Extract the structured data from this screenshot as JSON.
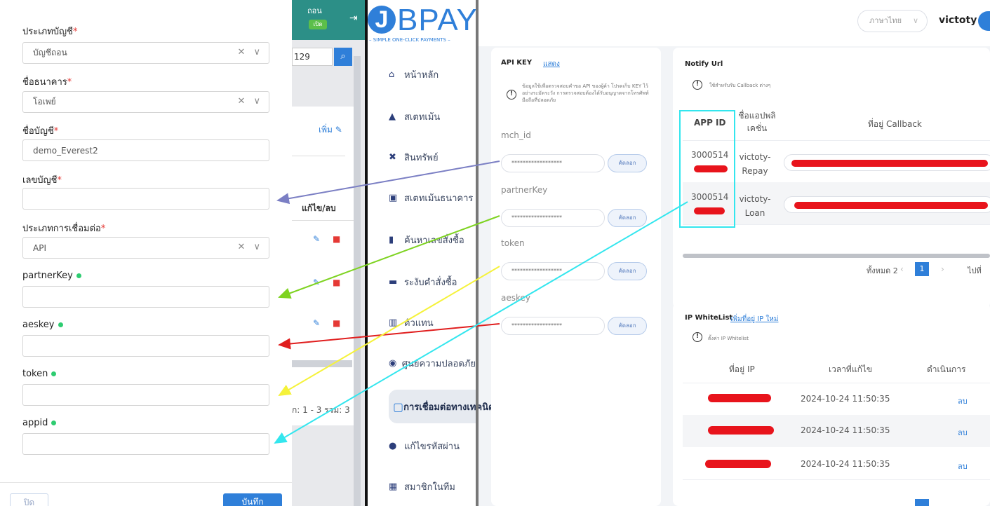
{
  "form": {
    "account_type": {
      "label": "ประเภทบัญชี",
      "req": "*",
      "value": "บัญชีถอน",
      "icons": "✕ ∨"
    },
    "bank_name": {
      "label": "ชื่อธนาคาร",
      "req": "*",
      "value": "โอเพย์",
      "icons": "✕ ∨"
    },
    "account_name": {
      "label": "ชื่อบัญชี",
      "req": "*",
      "value": "demo_Everest2"
    },
    "account_number": {
      "label": "เลขบัญชี",
      "req": "*",
      "value": ""
    },
    "connection_type": {
      "label": "ประเภทการเชื่อมต่อ",
      "req": "*",
      "value": "API",
      "icons": "✕ ∨"
    },
    "partnerKey": {
      "label": "partnerKey",
      "value": ""
    },
    "aeskey": {
      "label": "aeskey",
      "value": ""
    },
    "token": {
      "label": "token",
      "value": ""
    },
    "appid": {
      "label": "appid",
      "value": ""
    },
    "cancel_label": "ปิด",
    "save_label": "บันทึก"
  },
  "mid": {
    "withdraw_label": "ถอน",
    "toggle_label": "เปิด",
    "search_value": "129",
    "add_label": "เพิ่ม",
    "col_header": "แก้ไข/ลบ",
    "footer": "ก: 1 - 3 รวม: 3"
  },
  "brand": {
    "name": "BPAY",
    "initial": "J",
    "tagline": "– SIMPLE ONE-CLICK PAYMENTS –",
    "accent": "#2f7fd9"
  },
  "topbar": {
    "language": "ภาษาไทย",
    "username": "victoty"
  },
  "nav": [
    {
      "icon": "home-icon",
      "glyph": "⌂",
      "label": "หน้าหลัก"
    },
    {
      "icon": "bag-icon",
      "glyph": "▲",
      "label": "สเตทเม้น"
    },
    {
      "icon": "assets-icon",
      "glyph": "✖",
      "label": "สินทรัพย์"
    },
    {
      "icon": "clipboard-icon",
      "glyph": "▣",
      "label": "สเตทเม้นธนาคาร"
    },
    {
      "icon": "chart-icon",
      "glyph": "▮",
      "label": "ค้นหาเลขสั่งซื้อ"
    },
    {
      "icon": "order-icon",
      "glyph": "▬",
      "label": "ระงับคำสั่งซื้อ"
    },
    {
      "icon": "agent-icon",
      "glyph": "▥",
      "label": "ตัวแทน"
    },
    {
      "icon": "shield-icon",
      "glyph": "◉",
      "label": "ศูนย์ความปลอดภัย"
    },
    {
      "icon": "connect-icon",
      "glyph": "▢",
      "label": "การเชื่อมต่อทางเทคนิค"
    },
    {
      "icon": "user-icon",
      "glyph": "●",
      "label": "แก้ไขรหัสผ่าน"
    },
    {
      "icon": "grid-icon",
      "glyph": "▦",
      "label": "สมาชิกในทีม"
    }
  ],
  "apikey": {
    "title": "API KEY",
    "show_link": "แสดง",
    "note": "ข้อมูลใช้เพื่อตรวจสอบคำขอ API ของผู้ค้า โปรดเก็บ KEY ไว้อย่างระมัดระวัง การตรวจสอบต้องได้รับอนุญาตจากโทรศัพท์มือถือที่ปลอดภัย",
    "masked": "******************",
    "copy_label": "คัดลอก",
    "fields": [
      "mch_id",
      "partnerKey",
      "token",
      "aeskey"
    ]
  },
  "notify": {
    "title": "Notify Url",
    "note": "ใช้สำหรับรับ Callback ต่างๆ",
    "headers": {
      "app_id": "APP ID",
      "app_name": "ชื่อแอปพลิเคชั่น",
      "callback": "ที่อยู่ Callback"
    },
    "rows": [
      {
        "app_id": "3000514",
        "app_name": "victoty-Repay"
      },
      {
        "app_id": "3000514",
        "app_name": "victoty-Loan"
      }
    ],
    "pager": {
      "total": "ทั้งหมด 2",
      "page": "1",
      "goto": "ไปที่"
    }
  },
  "whitelist": {
    "title": "IP WhiteList",
    "add_link": "เพิ่มที่อยู่ IP ใหม่",
    "note": "ตั้งค่า IP Whitelist",
    "headers": {
      "ip": "ที่อยู่ IP",
      "time": "เวลาที่แก้ไข",
      "action": "ดำเนินการ"
    },
    "rows": [
      {
        "time": "2024-10-24 11:50:35",
        "action": "ลบ"
      },
      {
        "time": "2024-10-24 11:50:35",
        "action": "ลบ"
      },
      {
        "time": "2024-10-24 11:50:35",
        "action": "ลบ"
      }
    ]
  },
  "colors": {
    "redaction": "#e8141c",
    "arrow_purple": "#7b7fc4",
    "arrow_green": "#7ed321",
    "arrow_yellow": "#f5f23a",
    "arrow_red": "#e01e1e",
    "arrow_cyan": "#33e6ee"
  }
}
